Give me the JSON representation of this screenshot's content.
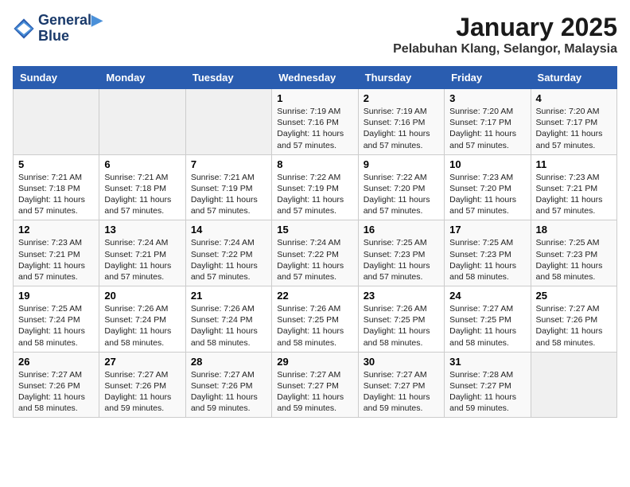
{
  "logo": {
    "line1": "General",
    "line2": "Blue"
  },
  "title": "January 2025",
  "subtitle": "Pelabuhan Klang, Selangor, Malaysia",
  "days_of_week": [
    "Sunday",
    "Monday",
    "Tuesday",
    "Wednesday",
    "Thursday",
    "Friday",
    "Saturday"
  ],
  "weeks": [
    [
      {
        "num": "",
        "info": ""
      },
      {
        "num": "",
        "info": ""
      },
      {
        "num": "",
        "info": ""
      },
      {
        "num": "1",
        "info": "Sunrise: 7:19 AM\nSunset: 7:16 PM\nDaylight: 11 hours and 57 minutes."
      },
      {
        "num": "2",
        "info": "Sunrise: 7:19 AM\nSunset: 7:16 PM\nDaylight: 11 hours and 57 minutes."
      },
      {
        "num": "3",
        "info": "Sunrise: 7:20 AM\nSunset: 7:17 PM\nDaylight: 11 hours and 57 minutes."
      },
      {
        "num": "4",
        "info": "Sunrise: 7:20 AM\nSunset: 7:17 PM\nDaylight: 11 hours and 57 minutes."
      }
    ],
    [
      {
        "num": "5",
        "info": "Sunrise: 7:21 AM\nSunset: 7:18 PM\nDaylight: 11 hours and 57 minutes."
      },
      {
        "num": "6",
        "info": "Sunrise: 7:21 AM\nSunset: 7:18 PM\nDaylight: 11 hours and 57 minutes."
      },
      {
        "num": "7",
        "info": "Sunrise: 7:21 AM\nSunset: 7:19 PM\nDaylight: 11 hours and 57 minutes."
      },
      {
        "num": "8",
        "info": "Sunrise: 7:22 AM\nSunset: 7:19 PM\nDaylight: 11 hours and 57 minutes."
      },
      {
        "num": "9",
        "info": "Sunrise: 7:22 AM\nSunset: 7:20 PM\nDaylight: 11 hours and 57 minutes."
      },
      {
        "num": "10",
        "info": "Sunrise: 7:23 AM\nSunset: 7:20 PM\nDaylight: 11 hours and 57 minutes."
      },
      {
        "num": "11",
        "info": "Sunrise: 7:23 AM\nSunset: 7:21 PM\nDaylight: 11 hours and 57 minutes."
      }
    ],
    [
      {
        "num": "12",
        "info": "Sunrise: 7:23 AM\nSunset: 7:21 PM\nDaylight: 11 hours and 57 minutes."
      },
      {
        "num": "13",
        "info": "Sunrise: 7:24 AM\nSunset: 7:21 PM\nDaylight: 11 hours and 57 minutes."
      },
      {
        "num": "14",
        "info": "Sunrise: 7:24 AM\nSunset: 7:22 PM\nDaylight: 11 hours and 57 minutes."
      },
      {
        "num": "15",
        "info": "Sunrise: 7:24 AM\nSunset: 7:22 PM\nDaylight: 11 hours and 57 minutes."
      },
      {
        "num": "16",
        "info": "Sunrise: 7:25 AM\nSunset: 7:23 PM\nDaylight: 11 hours and 57 minutes."
      },
      {
        "num": "17",
        "info": "Sunrise: 7:25 AM\nSunset: 7:23 PM\nDaylight: 11 hours and 58 minutes."
      },
      {
        "num": "18",
        "info": "Sunrise: 7:25 AM\nSunset: 7:23 PM\nDaylight: 11 hours and 58 minutes."
      }
    ],
    [
      {
        "num": "19",
        "info": "Sunrise: 7:25 AM\nSunset: 7:24 PM\nDaylight: 11 hours and 58 minutes."
      },
      {
        "num": "20",
        "info": "Sunrise: 7:26 AM\nSunset: 7:24 PM\nDaylight: 11 hours and 58 minutes."
      },
      {
        "num": "21",
        "info": "Sunrise: 7:26 AM\nSunset: 7:24 PM\nDaylight: 11 hours and 58 minutes."
      },
      {
        "num": "22",
        "info": "Sunrise: 7:26 AM\nSunset: 7:25 PM\nDaylight: 11 hours and 58 minutes."
      },
      {
        "num": "23",
        "info": "Sunrise: 7:26 AM\nSunset: 7:25 PM\nDaylight: 11 hours and 58 minutes."
      },
      {
        "num": "24",
        "info": "Sunrise: 7:27 AM\nSunset: 7:25 PM\nDaylight: 11 hours and 58 minutes."
      },
      {
        "num": "25",
        "info": "Sunrise: 7:27 AM\nSunset: 7:26 PM\nDaylight: 11 hours and 58 minutes."
      }
    ],
    [
      {
        "num": "26",
        "info": "Sunrise: 7:27 AM\nSunset: 7:26 PM\nDaylight: 11 hours and 58 minutes."
      },
      {
        "num": "27",
        "info": "Sunrise: 7:27 AM\nSunset: 7:26 PM\nDaylight: 11 hours and 59 minutes."
      },
      {
        "num": "28",
        "info": "Sunrise: 7:27 AM\nSunset: 7:26 PM\nDaylight: 11 hours and 59 minutes."
      },
      {
        "num": "29",
        "info": "Sunrise: 7:27 AM\nSunset: 7:27 PM\nDaylight: 11 hours and 59 minutes."
      },
      {
        "num": "30",
        "info": "Sunrise: 7:27 AM\nSunset: 7:27 PM\nDaylight: 11 hours and 59 minutes."
      },
      {
        "num": "31",
        "info": "Sunrise: 7:28 AM\nSunset: 7:27 PM\nDaylight: 11 hours and 59 minutes."
      },
      {
        "num": "",
        "info": ""
      }
    ]
  ]
}
